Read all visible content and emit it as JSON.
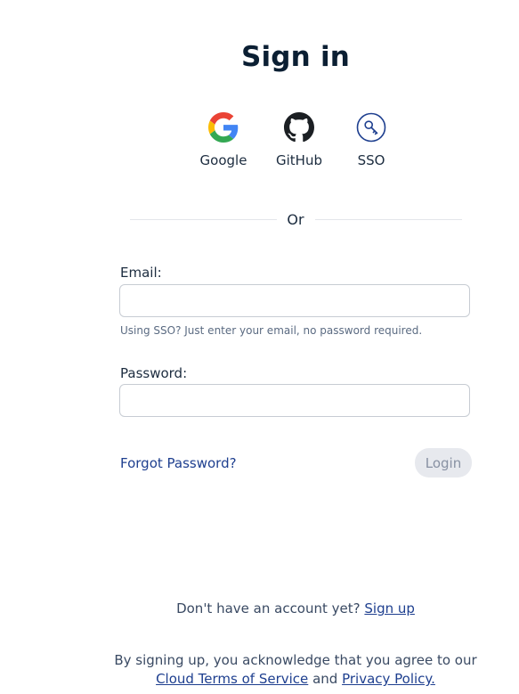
{
  "title": "Sign in",
  "providers": [
    {
      "label": "Google",
      "icon": "google-icon"
    },
    {
      "label": "GitHub",
      "icon": "github-icon"
    },
    {
      "label": "SSO",
      "icon": "key-icon"
    }
  ],
  "divider_text": "Or",
  "email": {
    "label": "Email:",
    "value": "",
    "placeholder": "",
    "hint": "Using SSO? Just enter your email, no password required."
  },
  "password": {
    "label": "Password:",
    "value": "",
    "placeholder": ""
  },
  "forgot_password_label": "Forgot Password?",
  "login_button_label": "Login",
  "signup": {
    "prompt": "Don't have an account yet?",
    "link_label": "Sign up"
  },
  "terms": {
    "prefix": "By signing up, you acknowledge that you agree to our",
    "terms_link": "Cloud Terms of Service",
    "conjunction": "and",
    "privacy_link": "Privacy Policy."
  },
  "colors": {
    "link": "#1e3f8f",
    "heading": "#0b1f33",
    "login_button_bg": "#e7e9ee",
    "sso_icon": "#1e3f8f"
  }
}
